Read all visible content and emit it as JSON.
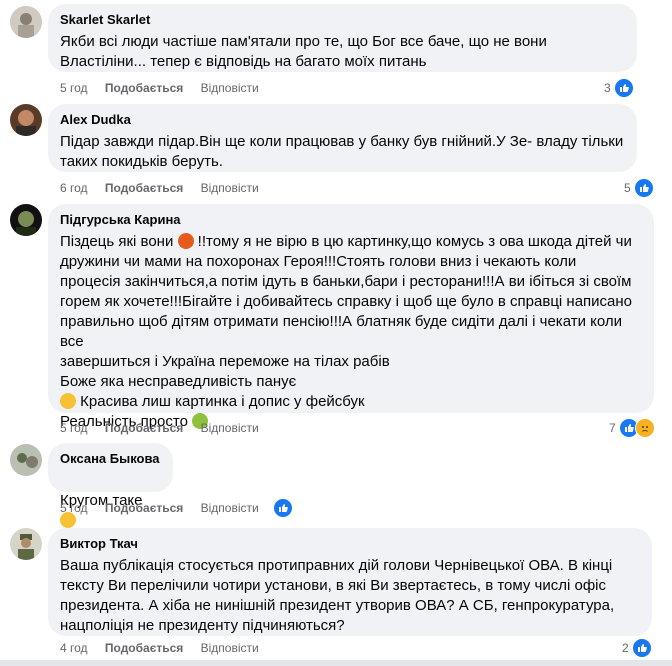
{
  "comments": [
    {
      "author": "Skarlet Skarlet",
      "text": "Якби всі люди частіше пам'ятали про те, що Бог все баче, що не вони Властіліни... тепер є відповідь на багато моїх питань",
      "time": "5 год",
      "like_label": "Подобається",
      "reply_label": "Відповісти",
      "reactions": "3"
    },
    {
      "author": "Alex Dudka",
      "text": "Підар завжди підар.Він ще коли працював у банку був гнійний.У Зе- владу тільки таких покидьків беруть.",
      "time": "6 год",
      "like_label": "Подобається",
      "reply_label": "Відповісти",
      "reactions": "5"
    },
    {
      "author": "Підгурська Карина",
      "text_lines": [
        "Піздець які вони",
        "!!тому я не вірю в цю картинку,що комусь з ова шкода дітей чи",
        "дружини чи мами на похоронах Героя!!!Стоять голови вниз і чекають коли",
        "процесія закінчиться,а потім ідуть в баньки,бари і ресторани!!!А ви ібіться зі своїм",
        "горем як хочете!!!Бігайте і добивайтесь справку і щоб ще було в справці написано",
        "правильно щоб дітям отримати пенсію!!!А блатняк буде сидіти далі і чекати коли все",
        "завершиться і Україна переможе на тілах рабів",
        "Боже яка несправедливість панує",
        "Красива лиш картинка і допис у фейсбук",
        "Реальність просто"
      ],
      "time": "5 год",
      "like_label": "Подобається",
      "reply_label": "Відповісти",
      "reactions": "7"
    },
    {
      "author": "Оксана Быкова",
      "text": "Кругом таке",
      "time": "5 год",
      "like_label": "Подобається",
      "reply_label": "Відповісти",
      "reactions": ""
    },
    {
      "author": "Виктор Ткач",
      "text": "Ваша публікація стосується протиправних дій голови Чернівецької ОВА. В кінці тексту Ви перелічили чотири установи, в які Ви звертаєтесь, в тому числі офіс президента. А хіба не нинішній президент утворив ОВА? А СБ, генпрокуратура, нацполіція не президенту підчиняються?",
      "time": "4 год",
      "like_label": "Подобається",
      "reply_label": "Відповісти",
      "reactions": "2"
    }
  ],
  "colors": {
    "like_blue": "#1877f2",
    "bubble": "#f0f2f5",
    "meta": "#65676b"
  },
  "icons": [
    "like-icon",
    "sad-icon",
    "angry-emoji",
    "disappointed-emoji",
    "nauseated-emoji",
    "worried-emoji"
  ]
}
